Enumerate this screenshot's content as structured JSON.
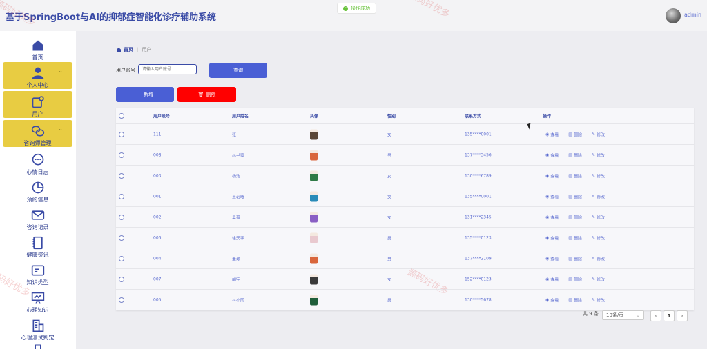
{
  "app": {
    "title": "基于SpringBoot与AI的抑郁症智能化诊疗辅助系统",
    "user": "admin"
  },
  "toast": {
    "text": "操作成功"
  },
  "sidebar": {
    "items": [
      {
        "label": "首页",
        "icon": "home-icon",
        "active": false
      },
      {
        "label": "个人中心",
        "icon": "person-icon",
        "active": true,
        "expandable": true
      },
      {
        "label": "用户",
        "icon": "user-card-icon",
        "active": true
      },
      {
        "label": "咨询师管理",
        "icon": "chat-link-icon",
        "active": true,
        "expandable": true
      },
      {
        "label": "心情日志",
        "icon": "speech-bubble-icon",
        "active": false
      },
      {
        "label": "预约信息",
        "icon": "pie-chart-icon",
        "active": false
      },
      {
        "label": "咨询记录",
        "icon": "mail-icon",
        "active": false
      },
      {
        "label": "健康资讯",
        "icon": "notebook-icon",
        "active": false
      },
      {
        "label": "知识类型",
        "icon": "id-card-icon",
        "active": false
      },
      {
        "label": "心理知识",
        "icon": "presentation-icon",
        "active": false
      },
      {
        "label": "心理测试判定",
        "icon": "buildings-icon",
        "active": false
      }
    ]
  },
  "breadcrumb": {
    "home": "首页",
    "current": "用户"
  },
  "search": {
    "label": "用户账号",
    "placeholder": "请输入用户账号",
    "button": "查询"
  },
  "actions": {
    "add": "新增",
    "delete": "删除"
  },
  "table": {
    "columns": [
      "用户账号",
      "用户姓名",
      "头像",
      "性别",
      "联系方式",
      "操作"
    ],
    "ops": {
      "view": "查看",
      "delete": "删除",
      "edit": "修改"
    },
    "rows": [
      {
        "account": "111",
        "name": "张一一",
        "gender": "女",
        "phone": "135****0001",
        "photo": "#5b4636"
      },
      {
        "account": "008",
        "name": "林书豪",
        "gender": "男",
        "phone": "137****3456",
        "photo": "#d9663c"
      },
      {
        "account": "003",
        "name": "杨洁",
        "gender": "女",
        "phone": "130****6789",
        "photo": "#2f7a46"
      },
      {
        "account": "001",
        "name": "王若曦",
        "gender": "女",
        "phone": "135****0001",
        "photo": "#2a8bb8"
      },
      {
        "account": "002",
        "name": "吴薇",
        "gender": "女",
        "phone": "131****2345",
        "photo": "#8a5fc4"
      },
      {
        "account": "006",
        "name": "徐天宇",
        "gender": "男",
        "phone": "135****0123",
        "photo": "#e9c9cf"
      },
      {
        "account": "004",
        "name": "董璟",
        "gender": "男",
        "phone": "137****2109",
        "photo": "#d9663c"
      },
      {
        "account": "007",
        "name": "胡宇",
        "gender": "女",
        "phone": "152****0123",
        "photo": "#3a3a3a"
      },
      {
        "account": "005",
        "name": "林小雨",
        "gender": "男",
        "phone": "130****5678",
        "photo": "#1f5e3a"
      }
    ]
  },
  "pagination": {
    "total": "共 9 条",
    "page_size": "10条/页",
    "current_page": "1"
  },
  "watermark": "源码好优多"
}
